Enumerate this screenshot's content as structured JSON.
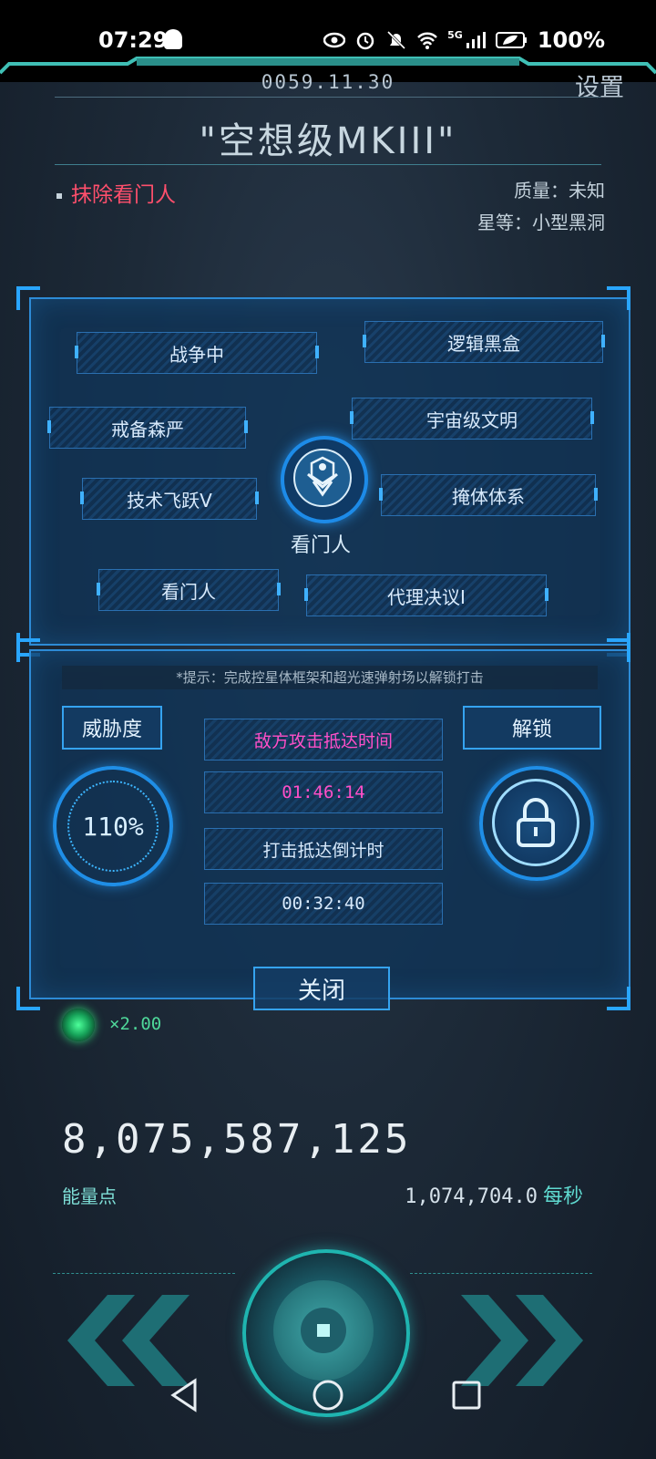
{
  "status_bar": {
    "time": "07:29",
    "notification_icon": "ghost-icon",
    "network_label": "5G",
    "battery": "100%",
    "icons": [
      "eye-icon",
      "alarm-icon",
      "bell-off-icon",
      "wifi-icon",
      "signal-icon",
      "battery-saver-icon"
    ]
  },
  "header": {
    "date": "0059.11.30",
    "settings_label": "设置",
    "title": "\"空想级MKIII\"",
    "mission": "抹除看门人",
    "quality": "质量：未知",
    "star_class": "星等：小型黑洞"
  },
  "traits": {
    "items": [
      "战争中",
      "逻辑黑盒",
      "戒备森严",
      "宇宙级文明",
      "技术飞跃V",
      "掩体体系",
      "看门人",
      "代理决议I"
    ],
    "center_label": "看门人",
    "center_icon": "watcher-emblem-icon"
  },
  "attack": {
    "hint": "*提示：完成控星体框架和超光速弹射场以解锁打击",
    "threat_label": "威胁度",
    "threat_value": "110%",
    "unlock_label": "解锁",
    "enemy_time_label": "敌方攻击抵达时间",
    "enemy_time_value": "01:46:14",
    "strike_label": "打击抵达倒计时",
    "strike_value": "00:32:40",
    "close_label": "关闭"
  },
  "economy": {
    "multiplier": "×2.00",
    "energy_total": "8,075,587,125",
    "energy_label": "能量点",
    "rate_value": "1,074,704.0",
    "rate_unit": "每秒"
  },
  "colors": {
    "accent": "#2d8bd6",
    "alert": "#ff4f6c",
    "enemy_time": "#ff4fc8",
    "teal": "#1fb5b0",
    "green": "#2ecc71"
  }
}
